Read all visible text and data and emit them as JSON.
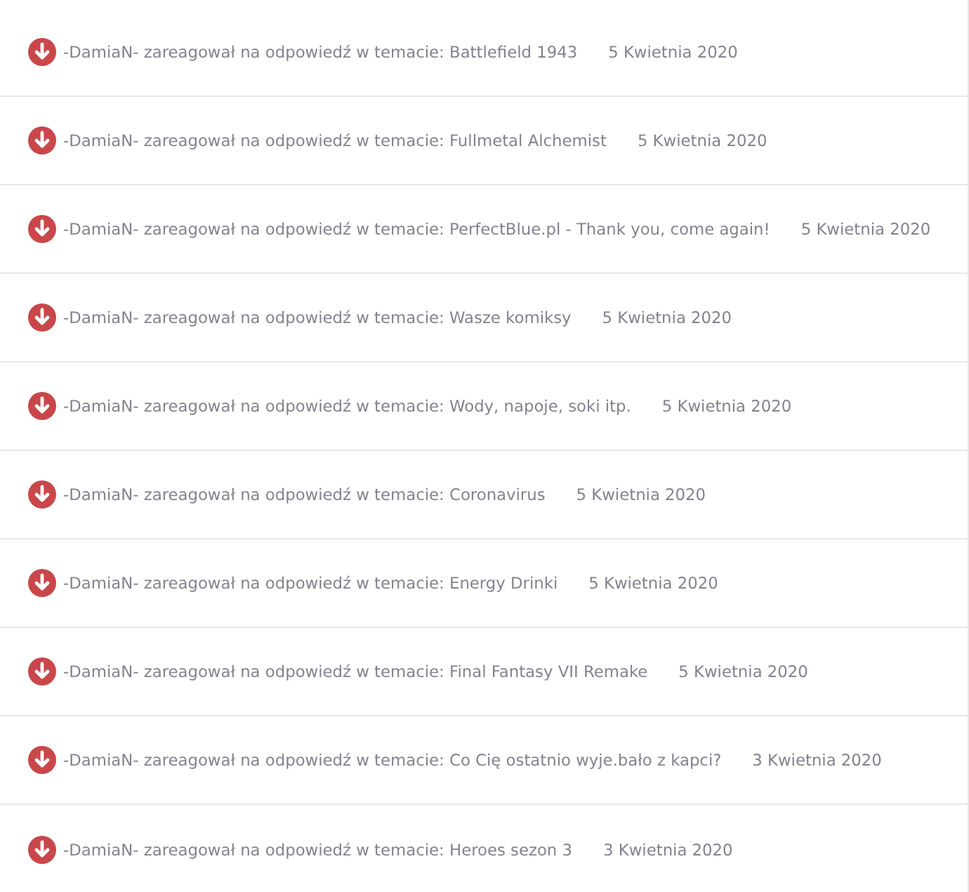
{
  "activities": [
    {
      "text": "-DamiaN- zareagował na odpowiedź w temacie: Battlefield 1943",
      "date": "5 Kwietnia 2020"
    },
    {
      "text": "-DamiaN- zareagował na odpowiedź w temacie: Fullmetal Alchemist",
      "date": "5 Kwietnia 2020"
    },
    {
      "text": "-DamiaN- zareagował na odpowiedź w temacie: PerfectBlue.pl - Thank you, come again!",
      "date": "5 Kwietnia 2020"
    },
    {
      "text": "-DamiaN- zareagował na odpowiedź w temacie: Wasze komiksy",
      "date": "5 Kwietnia 2020"
    },
    {
      "text": "-DamiaN- zareagował na odpowiedź w temacie: Wody, napoje, soki itp.",
      "date": "5 Kwietnia 2020"
    },
    {
      "text": "-DamiaN- zareagował na odpowiedź w temacie: Coronavirus",
      "date": "5 Kwietnia 2020"
    },
    {
      "text": "-DamiaN- zareagował na odpowiedź w temacie: Energy Drinki",
      "date": "5 Kwietnia 2020"
    },
    {
      "text": "-DamiaN- zareagował na odpowiedź w temacie: Final Fantasy VII Remake",
      "date": "5 Kwietnia 2020"
    },
    {
      "text": "-DamiaN- zareagował na odpowiedź w temacie: Co Cię ostatnio wyje.bało z kapci?",
      "date": "3 Kwietnia 2020"
    },
    {
      "text": "-DamiaN- zareagował na odpowiedź w temacie: Heroes sezon 3",
      "date": "3 Kwietnia 2020"
    }
  ]
}
